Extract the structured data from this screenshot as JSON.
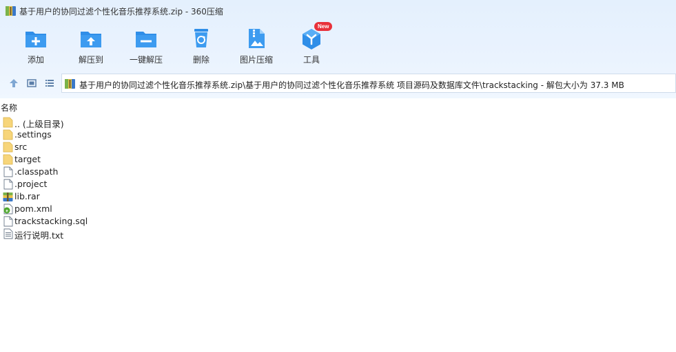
{
  "window": {
    "title": "基于用户的协同过滤个性化音乐推荐系统.zip - 360压缩"
  },
  "toolbar": {
    "items": [
      {
        "label": "添加",
        "icon": "add-folder-icon"
      },
      {
        "label": "解压到",
        "icon": "extract-to-icon"
      },
      {
        "label": "一键解压",
        "icon": "one-click-extract-icon"
      },
      {
        "label": "删除",
        "icon": "recycle-bin-icon"
      },
      {
        "label": "图片压缩",
        "icon": "image-compress-icon"
      },
      {
        "label": "工具",
        "icon": "tools-icon",
        "badge": "New"
      }
    ]
  },
  "nav": {
    "up_icon": "up-arrow-icon",
    "thumbnail_icon": "thumbnail-view-icon",
    "list_icon": "list-view-icon"
  },
  "address": {
    "path": "基于用户的协同过滤个性化音乐推荐系统.zip\\基于用户的协同过滤个性化音乐推荐系统 项目源码及数据库文件\\trackstacking - 解包大小为 37.3 MB"
  },
  "columns": {
    "name": "名称"
  },
  "files": [
    {
      "name": ".. (上级目录)",
      "type": "folder"
    },
    {
      "name": ".settings",
      "type": "folder"
    },
    {
      "name": "src",
      "type": "folder"
    },
    {
      "name": "target",
      "type": "folder"
    },
    {
      "name": ".classpath",
      "type": "file"
    },
    {
      "name": ".project",
      "type": "file"
    },
    {
      "name": "lib.rar",
      "type": "rar"
    },
    {
      "name": "pom.xml",
      "type": "xml"
    },
    {
      "name": "trackstacking.sql",
      "type": "file"
    },
    {
      "name": "运行说明.txt",
      "type": "text"
    }
  ],
  "colors": {
    "accent": "#2f8ee8",
    "toolbar_bg": "#e6f1fd",
    "folder": "#f7d57a",
    "badge": "#e8313a"
  }
}
